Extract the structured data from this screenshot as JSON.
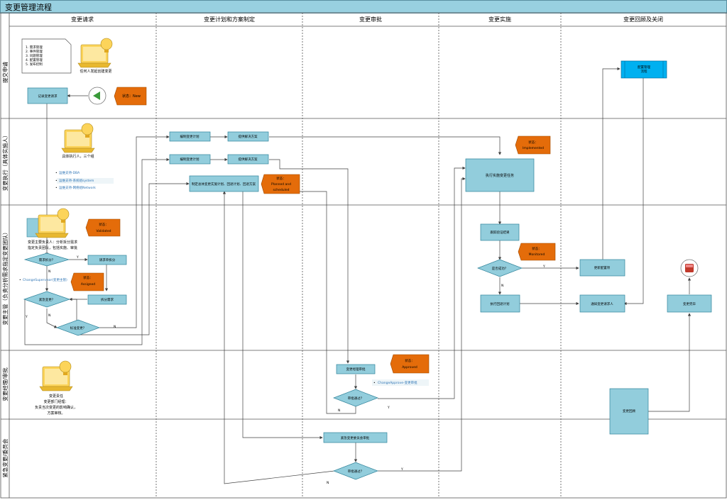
{
  "title": "变更管理流程",
  "columns": [
    "变更请求",
    "变更计划和方案制定",
    "变更审批",
    "变更实施",
    "变更回顾及关闭"
  ],
  "lanes": [
    "提交申请",
    "变更执行（具体实施人）",
    "变更主管（负责分析需求指定变更团队）",
    "变更经理/审批",
    "紧急变更/委员会"
  ],
  "colors": {
    "box": "#92cddc",
    "status": "#e46c0a",
    "header": "#98d0e0",
    "line": "#404040"
  },
  "doc_list": [
    "1. 需求管理",
    "2. 事件管理",
    "3. 问题管理",
    "4. 配置管理",
    "5. 发布控制"
  ],
  "roles": {
    "requester": "任何人发起创建变更",
    "executor": "具体执行人，三个组",
    "supervisor_l1": "变更主要负责人：分析拆分需求",
    "supervisor_l2": "指定负责团队，包括实施、审批",
    "manager_l1": "变更责任",
    "manager_l2": "变更部门经理：",
    "manager_l3": "负责当次变更的影响确认，",
    "manager_l4": "方案审核。"
  },
  "groups": [
    "运维支持-DBA",
    "运维支持-系统组system",
    "运维支持-网络组Network"
  ],
  "change_supervisor": "ChangeSupervisor(变更主管)",
  "change_approve": "ChangeApprove-变更审批",
  "status": {
    "new": "状态：New",
    "implemented_1": "状态：",
    "implemented_2": "Implemented",
    "planned_1": "状态：",
    "planned_2": "Planned and",
    "planned_3": "scheduled",
    "validated_1": "状态：",
    "validated_2": "Validated",
    "monitored_1": "状态：",
    "monitored_2": "Monitored",
    "assigned_1": "状态：",
    "assigned_2": "Assigned",
    "approved_1": "状态：",
    "approved_2": "Approved"
  },
  "boxes": {
    "record": "记录变更请求",
    "plan1": "编制变更计划",
    "submit1": "提供解决方案",
    "plan2": "编制变更计划",
    "submit2": "提供解决方案",
    "overall_plan": "制定总体变更实施计划、回退计划、回退方案",
    "implement": "执行实施变更任务",
    "track": "跟踪验证结果",
    "fallback": "执行回退计划",
    "config_update_1": "更新配置项",
    "notify": "通知变更请求人",
    "complete": "变更完毕",
    "config_mgmt_1": "配置管理",
    "config_mgmt_2": "流程",
    "split": "请求单拆分",
    "split_task": "拆分需求",
    "approve": "变更经理审批",
    "committee": "紧急变更委员会审批",
    "review": "变更回顾"
  },
  "diamonds": {
    "need_split": "需求拆分？",
    "urgent": "紧急变更？",
    "std": "标准变更？",
    "success": "是否成功？",
    "pass1": "审批通过？",
    "pass2": "审批通过？"
  },
  "edge_labels": {
    "y": "Y",
    "n": "N"
  }
}
